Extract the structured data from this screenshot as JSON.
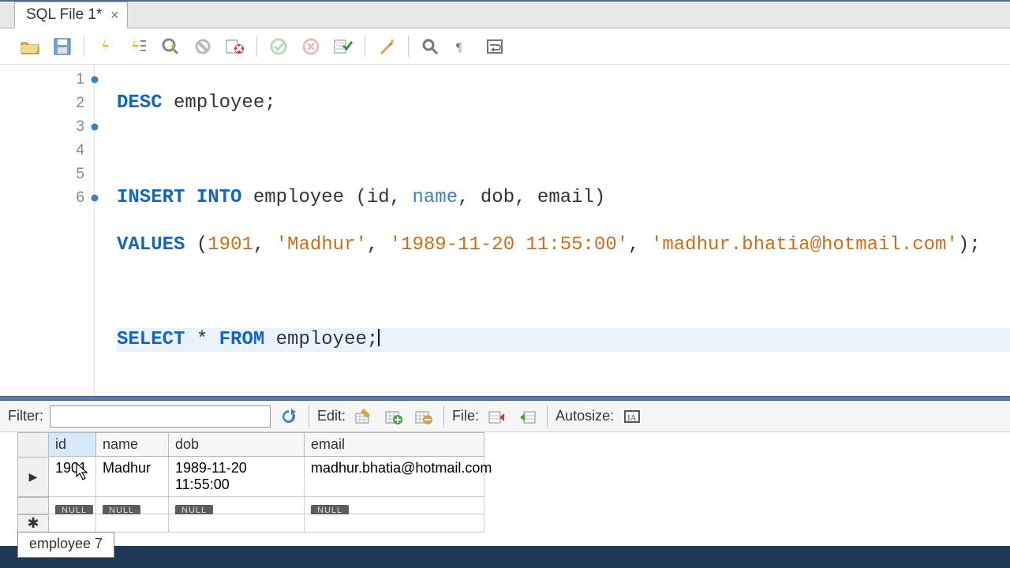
{
  "tab": {
    "title": "SQL File 1*"
  },
  "editor": {
    "lines": [
      {
        "n": 1,
        "marked": true
      },
      {
        "n": 2,
        "marked": false
      },
      {
        "n": 3,
        "marked": true
      },
      {
        "n": 4,
        "marked": false
      },
      {
        "n": 5,
        "marked": false
      },
      {
        "n": 6,
        "marked": true
      }
    ],
    "code": {
      "l1_kw": "DESC",
      "l1_rest": " employee;",
      "l3_kw": "INSERT INTO",
      "l3_rest_a": " employee (id, ",
      "l3_name": "name",
      "l3_rest_b": ", dob, email)",
      "l4_kw": "VALUES",
      "l4_open": " (",
      "l4_num": "1901",
      "l4_c1": ", ",
      "l4_s1": "'Madhur'",
      "l4_c2": ", ",
      "l4_s2": "'1989-11-20 11:55:00'",
      "l4_c3": ", ",
      "l4_s3": "'madhur.bhatia@hotmail.com'",
      "l4_close": ");",
      "l6_kw1": "SELECT",
      "l6_mid": " * ",
      "l6_kw2": "FROM",
      "l6_rest": " employee;"
    }
  },
  "results": {
    "filter_label": "Filter:",
    "filter_value": "",
    "edit_label": "Edit:",
    "file_label": "File:",
    "autosize_label": "Autosize:",
    "columns": [
      "id",
      "name",
      "dob",
      "email"
    ],
    "row": {
      "id": "1901",
      "name": "Madhur",
      "dob": "1989-11-20 11:55:00",
      "email": "madhur.bhatia@hotmail.com"
    },
    "null_label": "NULL",
    "tab_label": "employee 7"
  },
  "icons": {
    "open": "folder-open-icon",
    "save": "save-icon"
  }
}
